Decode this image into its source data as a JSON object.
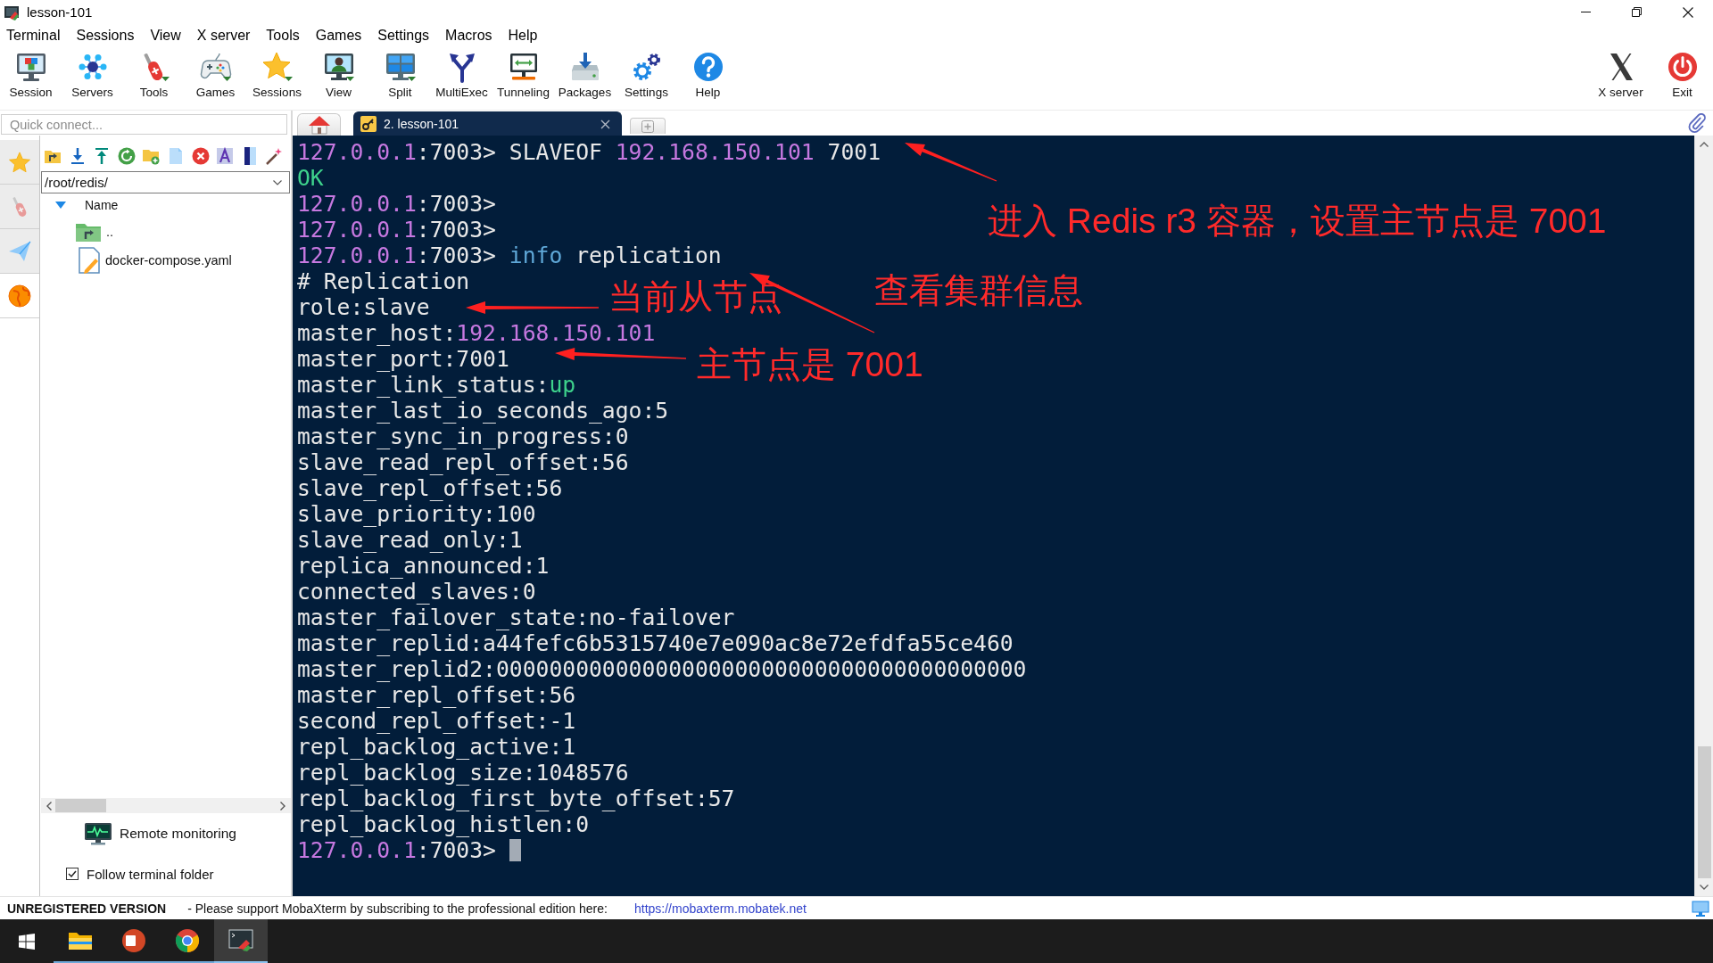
{
  "window": {
    "title": "lesson-101"
  },
  "menu_bar": [
    "Terminal",
    "Sessions",
    "View",
    "X server",
    "Tools",
    "Games",
    "Settings",
    "Macros",
    "Help"
  ],
  "toolbar": {
    "buttons": [
      "Session",
      "Servers",
      "Tools",
      "Games",
      "Sessions",
      "View",
      "Split",
      "MultiExec",
      "Tunneling",
      "Packages",
      "Settings",
      "Help"
    ],
    "right_buttons": [
      "X server",
      "Exit"
    ]
  },
  "quick_connect": {
    "placeholder": "Quick connect..."
  },
  "side_tabs": [
    {
      "selected": false
    },
    {
      "selected": false
    },
    {
      "selected": false
    },
    {
      "selected": true
    }
  ],
  "file_browser": {
    "path": "/root/redis/",
    "column": "Name",
    "files": [
      {
        "name": "..",
        "kind": "parent"
      },
      {
        "name": "docker-compose.yaml",
        "kind": "file"
      }
    ],
    "remote_monitoring": "Remote monitoring",
    "follow_terminal_folder": {
      "label": "Follow terminal folder",
      "checked": true
    }
  },
  "tabs": [
    {
      "kind": "home",
      "selected": false
    },
    {
      "kind": "session",
      "label": "2. lesson-101",
      "selected": true
    },
    {
      "kind": "new",
      "selected": false
    }
  ],
  "terminal": {
    "cursor": true,
    "lines": [
      {
        "spans": [
          {
            "kind": "address",
            "text": "127.0.0.1"
          },
          {
            "kind": "plain",
            "text": ":7003> SLAVEOF "
          },
          {
            "kind": "address",
            "text": "192.168.150.101"
          },
          {
            "kind": "plain",
            "text": " 7001"
          }
        ]
      },
      {
        "spans": [
          {
            "kind": "success",
            "text": "OK"
          }
        ]
      },
      {
        "spans": [
          {
            "kind": "address",
            "text": "127.0.0.1"
          },
          {
            "kind": "plain",
            "text": ":7003>"
          }
        ]
      },
      {
        "spans": [
          {
            "kind": "address",
            "text": "127.0.0.1"
          },
          {
            "kind": "plain",
            "text": ":7003>"
          }
        ]
      },
      {
        "spans": [
          {
            "kind": "address",
            "text": "127.0.0.1"
          },
          {
            "kind": "plain",
            "text": ":7003> "
          },
          {
            "kind": "keyword",
            "text": "info"
          },
          {
            "kind": "plain",
            "text": " replication"
          }
        ]
      },
      {
        "spans": [
          {
            "kind": "plain",
            "text": "# Replication"
          }
        ]
      },
      {
        "spans": [
          {
            "kind": "plain",
            "text": "role:slave"
          }
        ]
      },
      {
        "spans": [
          {
            "kind": "plain",
            "text": "master_host:"
          },
          {
            "kind": "address",
            "text": "192.168.150.101"
          }
        ]
      },
      {
        "spans": [
          {
            "kind": "plain",
            "text": "master_port:7001"
          }
        ]
      },
      {
        "spans": [
          {
            "kind": "plain",
            "text": "master_link_status:"
          },
          {
            "kind": "success",
            "text": "up"
          }
        ]
      },
      {
        "spans": [
          {
            "kind": "plain",
            "text": "master_last_io_seconds_ago:5"
          }
        ]
      },
      {
        "spans": [
          {
            "kind": "plain",
            "text": "master_sync_in_progress:0"
          }
        ]
      },
      {
        "spans": [
          {
            "kind": "plain",
            "text": "slave_read_repl_offset:56"
          }
        ]
      },
      {
        "spans": [
          {
            "kind": "plain",
            "text": "slave_repl_offset:56"
          }
        ]
      },
      {
        "spans": [
          {
            "kind": "plain",
            "text": "slave_priority:100"
          }
        ]
      },
      {
        "spans": [
          {
            "kind": "plain",
            "text": "slave_read_only:1"
          }
        ]
      },
      {
        "spans": [
          {
            "kind": "plain",
            "text": "replica_announced:1"
          }
        ]
      },
      {
        "spans": [
          {
            "kind": "plain",
            "text": "connected_slaves:0"
          }
        ]
      },
      {
        "spans": [
          {
            "kind": "plain",
            "text": "master_failover_state:no-failover"
          }
        ]
      },
      {
        "spans": [
          {
            "kind": "plain",
            "text": "master_replid:a44fefc6b5315740e7e090ac8e72efdfa55ce460"
          }
        ]
      },
      {
        "spans": [
          {
            "kind": "plain",
            "text": "master_replid2:0000000000000000000000000000000000000000"
          }
        ]
      },
      {
        "spans": [
          {
            "kind": "plain",
            "text": "master_repl_offset:56"
          }
        ]
      },
      {
        "spans": [
          {
            "kind": "plain",
            "text": "second_repl_offset:-1"
          }
        ]
      },
      {
        "spans": [
          {
            "kind": "plain",
            "text": "repl_backlog_active:1"
          }
        ]
      },
      {
        "spans": [
          {
            "kind": "plain",
            "text": "repl_backlog_size:1048576"
          }
        ]
      },
      {
        "spans": [
          {
            "kind": "plain",
            "text": "repl_backlog_first_byte_offset:57"
          }
        ]
      },
      {
        "spans": [
          {
            "kind": "plain",
            "text": "repl_backlog_histlen:0"
          }
        ]
      },
      {
        "spans": [
          {
            "kind": "address",
            "text": "127.0.0.1"
          },
          {
            "kind": "plain",
            "text": ":7003>"
          }
        ]
      }
    ]
  },
  "annotations": [
    "进入 Redis r3 容器，设置主节点是 7001",
    "查看集群信息",
    "当前从节点",
    "主节点是 7001"
  ],
  "status_bar": {
    "edition": "UNREGISTERED VERSION",
    "message": "- Please support MobaXterm by subscribing to the professional edition here:",
    "link": "https://mobaxterm.mobatek.net"
  },
  "taskbar": {
    "apps": [
      {
        "selected": false
      },
      {
        "selected": false
      },
      {
        "selected": false
      },
      {
        "selected": true
      }
    ]
  }
}
